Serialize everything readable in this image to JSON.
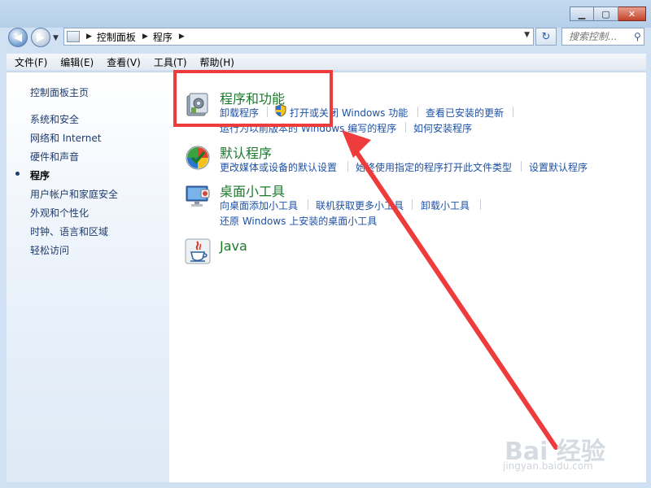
{
  "window": {
    "minimize": "▁",
    "maximize": "▢",
    "close": "✕"
  },
  "nav": {
    "back": "◀",
    "forward": "▶",
    "dropdown": "▼"
  },
  "address": {
    "crumbs": [
      "控制面板",
      "程序"
    ],
    "arrow": "▶",
    "dropdown": "▼"
  },
  "refresh_glyph": "↻",
  "search": {
    "placeholder": "搜索控制...",
    "icon": "⚲"
  },
  "menu": [
    "文件(F)",
    "编辑(E)",
    "查看(V)",
    "工具(T)",
    "帮助(H)"
  ],
  "sidebar": {
    "items": [
      {
        "label": "控制面板主页"
      },
      {
        "label": "系统和安全"
      },
      {
        "label": "网络和 Internet"
      },
      {
        "label": "硬件和声音"
      },
      {
        "label": "程序",
        "current": true
      },
      {
        "label": "用户帐户和家庭安全"
      },
      {
        "label": "外观和个性化"
      },
      {
        "label": "时钟、语言和区域"
      },
      {
        "label": "轻松访问"
      }
    ]
  },
  "categories": [
    {
      "title": "程序和功能",
      "icon": "programs-features-icon",
      "tasks": [
        "卸载程序",
        "打开或关闭 Windows 功能",
        "查看已安装的更新",
        "运行为以前版本的 Windows 编写的程序",
        "如何安装程序"
      ]
    },
    {
      "title": "默认程序",
      "icon": "default-programs-icon",
      "tasks": [
        "更改媒体或设备的默认设置",
        "始终使用指定的程序打开此文件类型",
        "设置默认程序"
      ]
    },
    {
      "title": "桌面小工具",
      "icon": "desktop-gadgets-icon",
      "tasks": [
        "向桌面添加小工具",
        "联机获取更多小工具",
        "卸载小工具",
        "还原 Windows 上安装的桌面小工具"
      ]
    },
    {
      "title": "Java",
      "icon": "java-icon",
      "tasks": []
    }
  ],
  "watermark": {
    "brand": "Bai 经验",
    "url": "jingyan.baidu.com"
  },
  "colors": {
    "category_title": "#1a7a2b",
    "link": "#1e51a4",
    "annotation_red": "#ee3b3b"
  }
}
